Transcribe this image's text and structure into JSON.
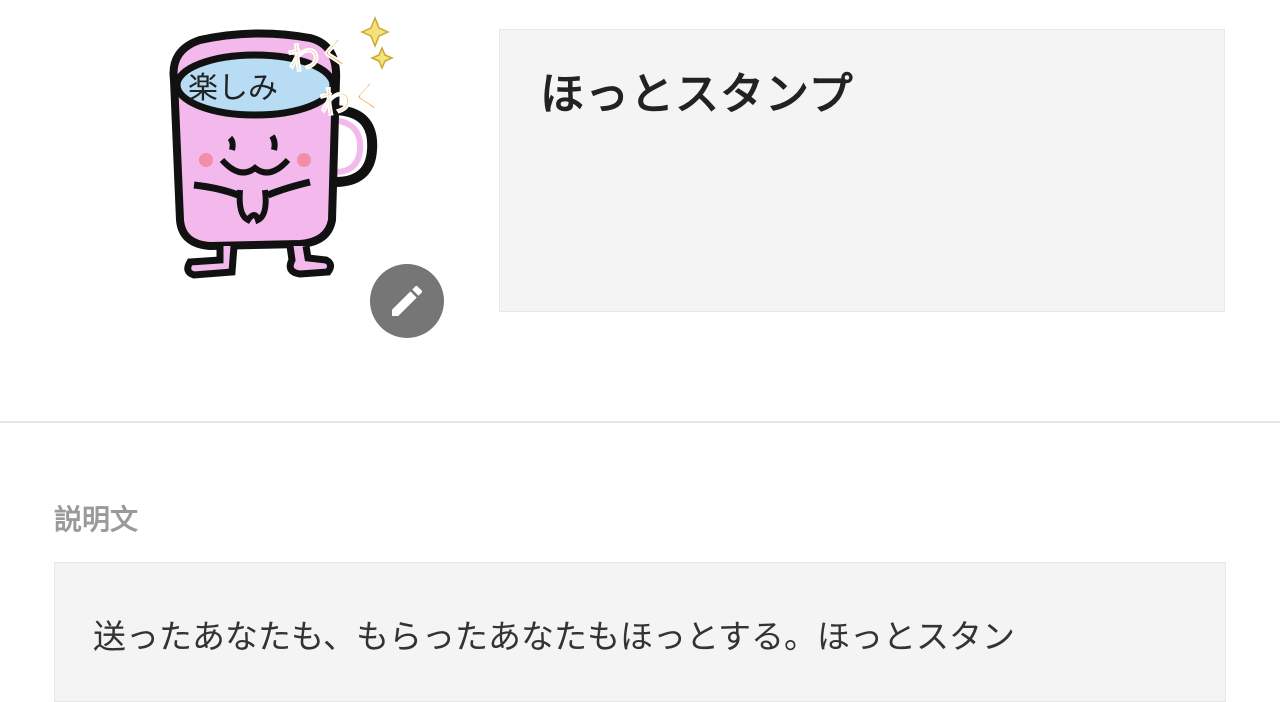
{
  "sticker": {
    "mug_label": "楽しみ",
    "sparkle_text_1": "わく",
    "sparkle_text_2": "わく",
    "edit_icon": "pencil-icon"
  },
  "title": "ほっとスタンプ",
  "description": {
    "label": "説明文",
    "text": "送ったあなたも、もらったあなたもほっとする。ほっとスタン"
  },
  "colors": {
    "mug_pink": "#f3b9ec",
    "mug_blue": "#b7dcf3",
    "accent_orange": "#f29a1d",
    "edit_button": "#767676",
    "box_bg": "#f4f4f4"
  }
}
